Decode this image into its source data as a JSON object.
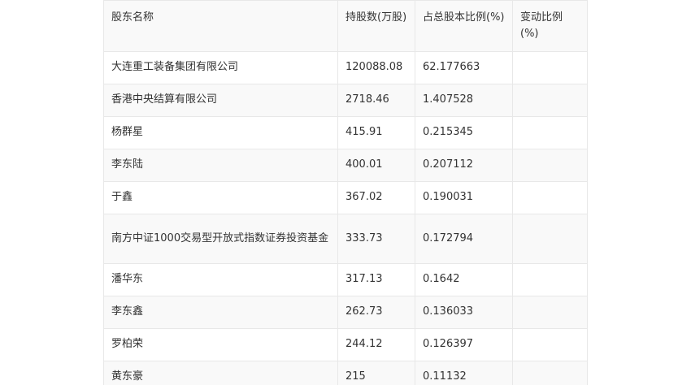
{
  "table": {
    "headers": [
      "股东名称",
      "持股数(万股)",
      "占总股本比例(%)",
      "变动比例(%)"
    ],
    "rows": [
      [
        "大连重工装备集团有限公司",
        "120088.08",
        "62.177663",
        ""
      ],
      [
        "香港中央结算有限公司",
        "2718.46",
        "1.407528",
        ""
      ],
      [
        "杨群星",
        "415.91",
        "0.215345",
        ""
      ],
      [
        "李东陆",
        "400.01",
        "0.207112",
        ""
      ],
      [
        "于鑫",
        "367.02",
        "0.190031",
        ""
      ],
      [
        "南方中证1000交易型开放式指数证券投资基金",
        "333.73",
        "0.172794",
        ""
      ],
      [
        "潘华东",
        "317.13",
        "0.1642",
        ""
      ],
      [
        "李东鑫",
        "262.73",
        "0.136033",
        ""
      ],
      [
        "罗柏荣",
        "244.12",
        "0.126397",
        ""
      ],
      [
        "黄东豪",
        "215",
        "0.11132",
        ""
      ]
    ]
  }
}
